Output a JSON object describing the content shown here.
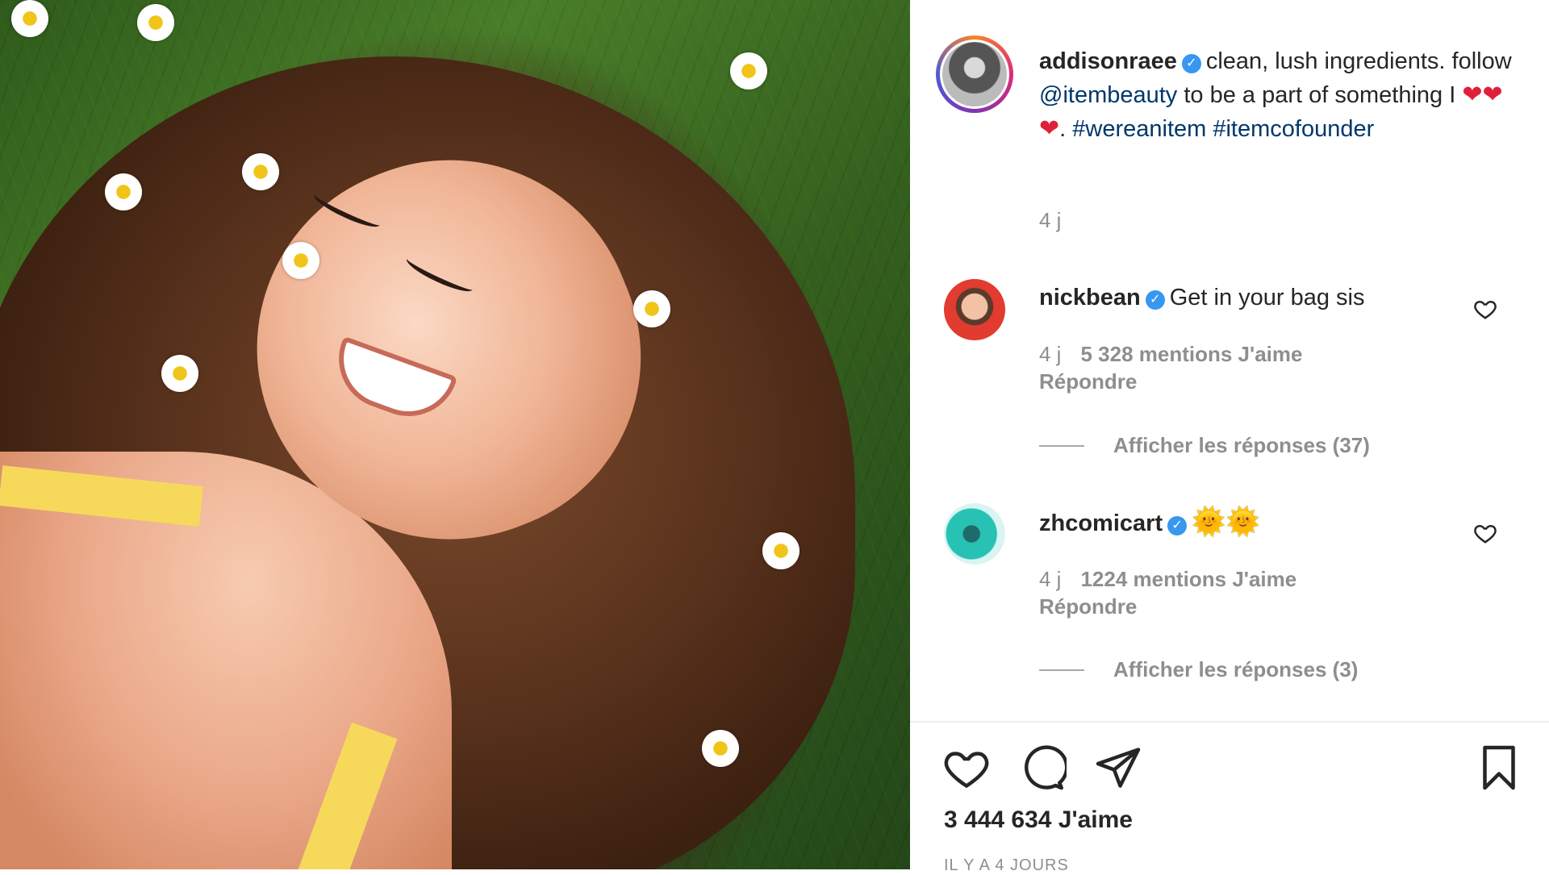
{
  "post": {
    "author": "addisonraee",
    "caption_text_1": "clean, lush ingredients. follow ",
    "caption_mention": "@itembeauty",
    "caption_text_2": " to be a part of something I ",
    "caption_hearts": "❤❤❤",
    "caption_text_3": ". ",
    "caption_hashtag_1": "#wereanitem",
    "caption_hashtag_2": "#itemcofounder",
    "time": "4 j",
    "likes": "3 444 634 J'aime",
    "posted_ago": "IL Y A 4 JOURS"
  },
  "comments": [
    {
      "username": "nickbean",
      "text": "Get in your bag sis",
      "time": "4 j",
      "likes": "5 328 mentions J'aime",
      "reply": "Répondre",
      "view_replies": "Afficher les réponses (37)"
    },
    {
      "username": "zhcomicart",
      "text": "🌞🌞",
      "time": "4 j",
      "likes": "1224 mentions J'aime",
      "reply": "Répondre",
      "view_replies": "Afficher les réponses (3)"
    }
  ],
  "icons": {
    "verified": "verified-badge-icon",
    "like": "heart-outline-icon",
    "comment": "comment-bubble-icon",
    "share": "paper-plane-icon",
    "save": "bookmark-icon"
  },
  "colors": {
    "link": "#00376b",
    "verified": "#3897f0",
    "muted": "#8e8e8e",
    "heart": "#e0203a"
  }
}
